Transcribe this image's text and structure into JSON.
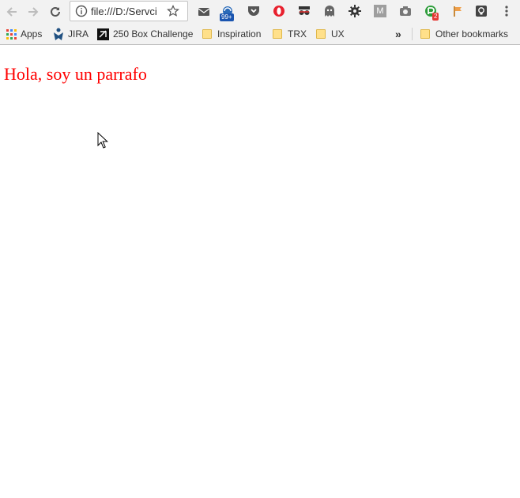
{
  "omnibox": {
    "url": "file:///D:/Servci"
  },
  "extensions": {
    "badge_mail": "99+",
    "badge_green": "2",
    "m_letter": "M"
  },
  "bookmarks": [
    {
      "label": "Apps"
    },
    {
      "label": "JIRA"
    },
    {
      "label": "250 Box Challenge"
    },
    {
      "label": "Inspiration"
    },
    {
      "label": "TRX"
    },
    {
      "label": "UX"
    }
  ],
  "bookmarks_overflow": "»",
  "other_bookmarks": "Other bookmarks",
  "page": {
    "paragraph": "Hola, soy un parrafo",
    "paragraph_color": "#ff0000"
  }
}
